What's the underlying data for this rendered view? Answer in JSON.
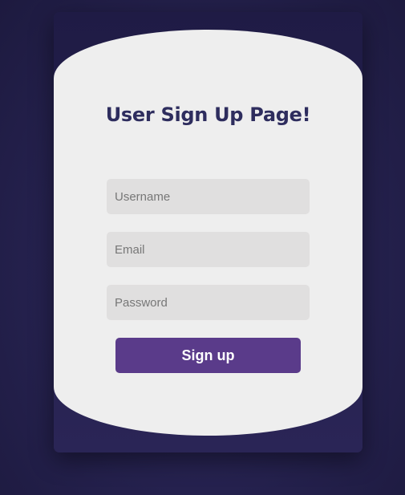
{
  "form": {
    "title": "User Sign Up Page!",
    "username_placeholder": "Username",
    "email_placeholder": "Email",
    "password_placeholder": "Password",
    "submit_label": "Sign up"
  },
  "colors": {
    "background": "#272352",
    "panel": "#eeeeee",
    "title": "#2e2d5e",
    "field": "#e0dfdf",
    "button": "#5a3b8a"
  }
}
